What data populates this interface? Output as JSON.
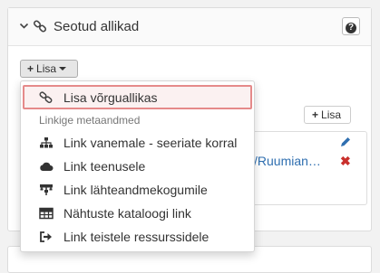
{
  "panel": {
    "title": "Seotud allikad",
    "help_icon": "question-icon",
    "add_button_label": "Lisa",
    "secondary_add_label": "Lisa",
    "row_link_text": "/Ruumian…"
  },
  "dropdown": {
    "items": [
      {
        "label": "Lisa võrguallikas",
        "icon": "link-icon",
        "selected": true
      }
    ],
    "section_header": "Linkige metaandmed",
    "section_items": [
      {
        "label": "Link vanemale - seeriate korral",
        "icon": "sitemap-icon"
      },
      {
        "label": "Link teenusele",
        "icon": "cloud-icon"
      },
      {
        "label": "Link lähteandmekogumile",
        "icon": "database-tree-icon"
      },
      {
        "label": "Nähtuste kataloogi link",
        "icon": "table-icon"
      },
      {
        "label": "Link teistele ressurssidele",
        "icon": "sign-out-icon"
      }
    ]
  },
  "colors": {
    "highlight_border": "#e58a8a",
    "link_blue": "#2f6fb0",
    "delete_red": "#c9302c"
  }
}
